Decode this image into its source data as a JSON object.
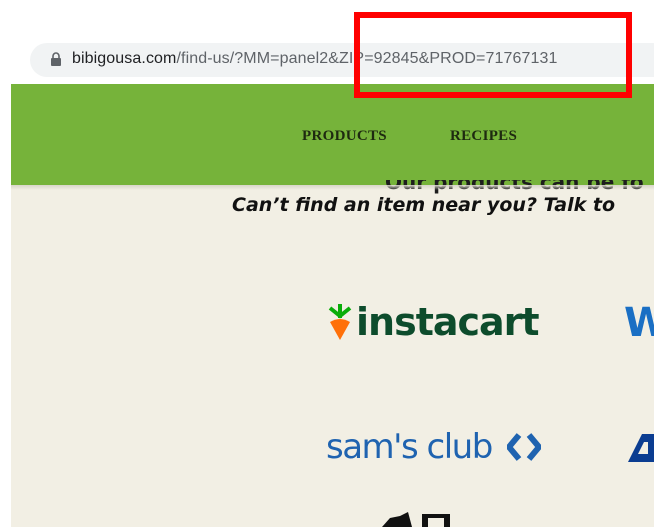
{
  "browser": {
    "url_domain": "bibigousa.com",
    "url_path": "/find-us/?MM=panel2&ZIP=92845&PROD=71767131"
  },
  "nav": {
    "items": [
      "PRODUCTS",
      "RECIPES"
    ]
  },
  "content": {
    "blurb_top": "Our products can be fo",
    "blurb": "Can’t find an item near you? Talk to"
  },
  "retailers": {
    "instacart": "instacart",
    "walmart_partial": "W",
    "sams_club": "sam's club"
  },
  "colors": {
    "nav_green": "#76b33a",
    "content_bg": "#f2efe4",
    "instacart_green": "#0d4c2c",
    "instacart_carrot": "#ff7009",
    "sams_blue": "#1f63b0",
    "annotation_red": "#ff0000"
  },
  "icons": [
    "lock-icon",
    "instacart-carrot-icon",
    "sams-club-diamond-icon",
    "albertsons-logo-icon"
  ]
}
